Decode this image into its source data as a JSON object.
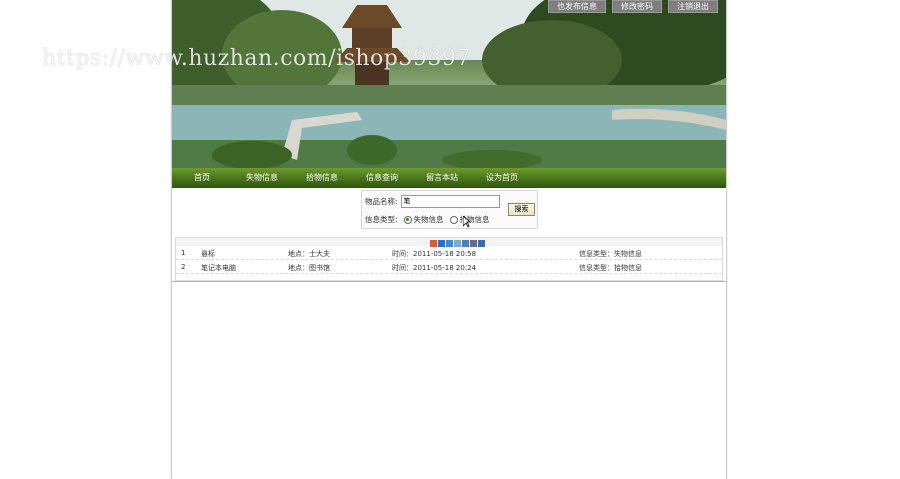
{
  "header": {
    "buttons": [
      "也发布信息",
      "修改密码",
      "注销退出"
    ]
  },
  "nav": {
    "items": [
      "首页",
      "失物信息",
      "拾物信息",
      "信息查询",
      "留言本站",
      "设为首页"
    ]
  },
  "search": {
    "name_label": "物品名称:",
    "name_value": "笔",
    "type_label": "信息类型:",
    "option_lost": "失物信息",
    "option_found": "拾物信息",
    "selected": "失物信息",
    "submit_label": "搜索"
  },
  "results": {
    "rows": [
      {
        "index": "1",
        "name": "悬标",
        "place": "地点：士大夫",
        "time": "时间：2011-05-18 20:58",
        "type": "信息类型：失物信息"
      },
      {
        "index": "2",
        "name": "笔记本电脑",
        "place": "地点：图书馆",
        "time": "时间：2011-05-18 20:24",
        "type": "信息类型：拾物信息"
      }
    ]
  },
  "watermark": "https://www.huzhan.com/ishop39397",
  "colors": {
    "nav_green": "#4f7a1c",
    "radio_selected": "#2a7a2a"
  }
}
